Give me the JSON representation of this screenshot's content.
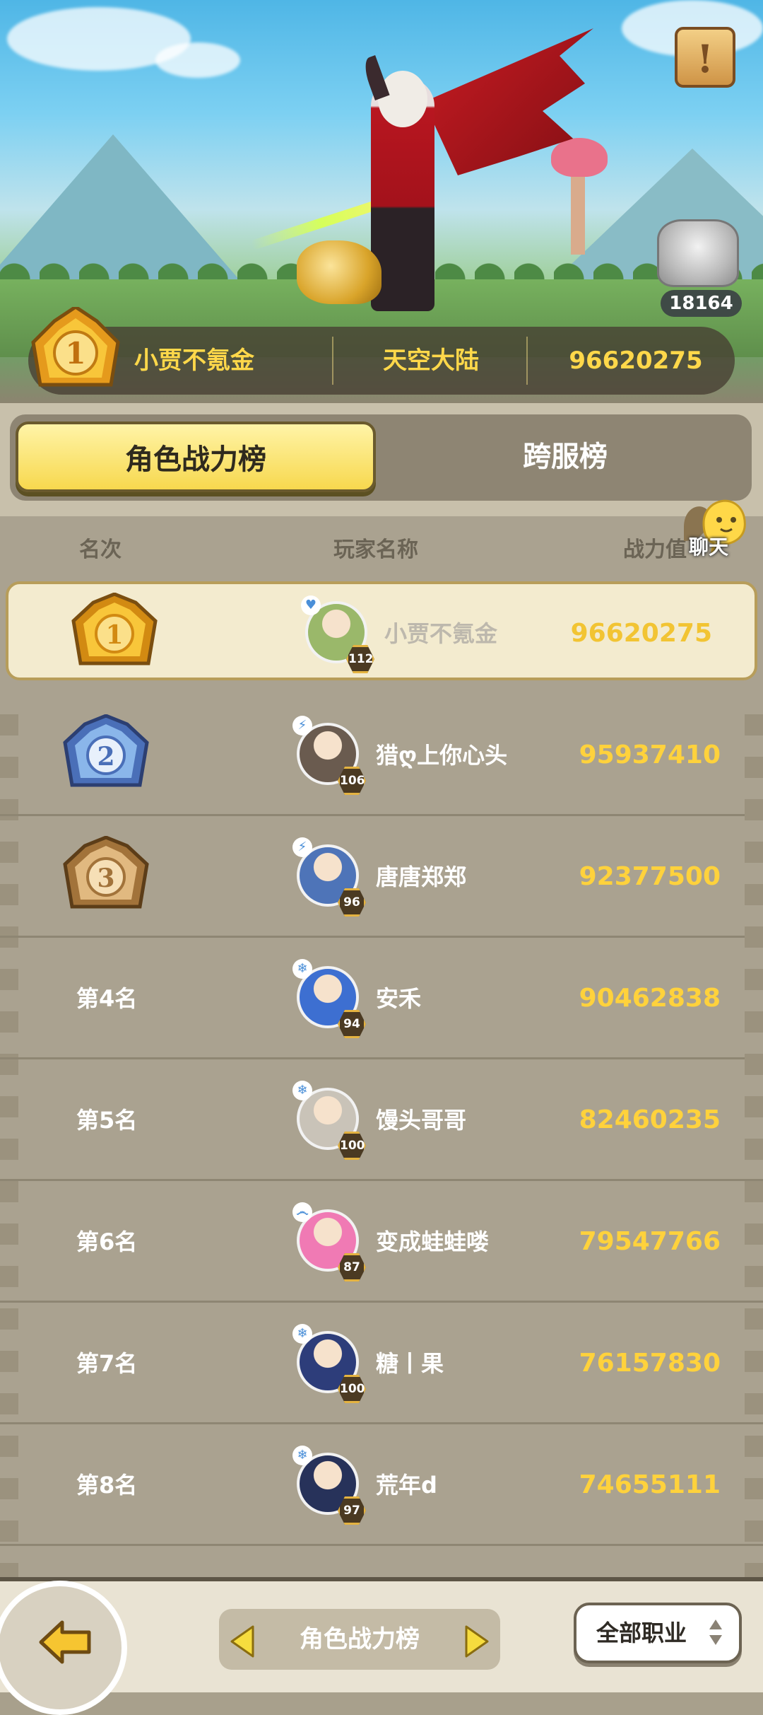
{
  "hero": {
    "notice_glyph": "!",
    "trophy_count": "18164",
    "champion": {
      "rank": "1",
      "name": "小贾不氪金",
      "server": "天空大陆",
      "power": "96620275"
    }
  },
  "tabs": {
    "active": "角色战力榜",
    "other": "跨服榜"
  },
  "columns": {
    "rank": "名次",
    "player": "玩家名称",
    "power": "战力值"
  },
  "chat": {
    "label": "聊天"
  },
  "rows": [
    {
      "rank": "1",
      "medal": "gold",
      "name": "小贾不氪金",
      "level": "112",
      "power": "96620275",
      "tag": "♥",
      "avatar_color": "#9ab86a"
    },
    {
      "rank": "2",
      "medal": "silver",
      "name": "猎ღ上你心头",
      "level": "106",
      "power": "95937410",
      "tag": "⚡",
      "avatar_color": "#6a5b4f"
    },
    {
      "rank": "3",
      "medal": "bronze",
      "name": "唐唐郑郑",
      "level": "96",
      "power": "92377500",
      "tag": "⚡",
      "avatar_color": "#4e74b8"
    },
    {
      "rank": "第4名",
      "name": "安禾",
      "level": "94",
      "power": "90462838",
      "tag": "❄",
      "avatar_color": "#3d6fd1"
    },
    {
      "rank": "第5名",
      "name": "馒头哥哥",
      "level": "100",
      "power": "82460235",
      "tag": "❄",
      "avatar_color": "#c9c3b8"
    },
    {
      "rank": "第6名",
      "name": "变成蛙蛙喽",
      "level": "87",
      "power": "79547766",
      "tag": "෴",
      "avatar_color": "#f07ab4"
    },
    {
      "rank": "第7名",
      "name": "糖丨果",
      "level": "100",
      "power": "76157830",
      "tag": "❄",
      "avatar_color": "#2d3d7a"
    },
    {
      "rank": "第8名",
      "name": "荒年d",
      "level": "97",
      "power": "74655111",
      "tag": "❄",
      "avatar_color": "#27325a"
    }
  ],
  "bottom": {
    "switch_label": "角色战力榜",
    "job_filter": "全部职业"
  },
  "colors": {
    "gold_text": "#ffd23c",
    "tab_active": "#f7d84e",
    "list_bg": "#aaa290"
  }
}
